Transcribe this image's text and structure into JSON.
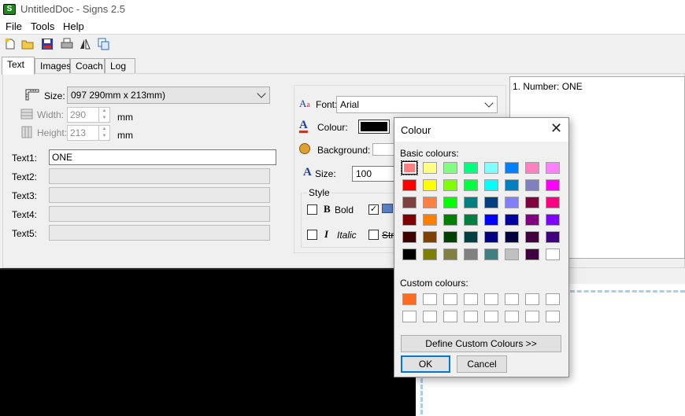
{
  "window": {
    "title": "UntitledDoc - Signs 2.5",
    "app_icon": "S"
  },
  "menu": [
    "File",
    "Tools",
    "Help"
  ],
  "toolbar_icons": [
    "new-file-icon",
    "open-folder-icon",
    "save-icon",
    "print-icon",
    "mirror-icon",
    "copy-icon"
  ],
  "tabs": [
    "Text",
    "Images",
    "Coach",
    "Log"
  ],
  "size": {
    "label": "Size:",
    "value": "097 290mm x 213mm)"
  },
  "width": {
    "label": "Width:",
    "value": "290",
    "unit": "mm"
  },
  "height": {
    "label": "Height:",
    "value": "213",
    "unit": "mm"
  },
  "texts": [
    {
      "label": "Text1:",
      "value": "ONE"
    },
    {
      "label": "Text2:",
      "value": ""
    },
    {
      "label": "Text3:",
      "value": ""
    },
    {
      "label": "Text4:",
      "value": ""
    },
    {
      "label": "Text5:",
      "value": ""
    }
  ],
  "font": {
    "label": "Font:",
    "value": "Arial"
  },
  "colour": {
    "label": "Colour:",
    "swatch": "#000000"
  },
  "background": {
    "label": "Background:"
  },
  "font_size": {
    "label": "Size:",
    "value": "100"
  },
  "style": {
    "title": "Style",
    "bold": "Bold",
    "italic": "Italic",
    "strike": "Stri"
  },
  "number_list": [
    "1. Number: ONE"
  ],
  "dialog": {
    "title": "Colour",
    "basic_label": "Basic colours:",
    "custom_label": "Custom colours:",
    "define_button": "Define Custom Colours >>",
    "ok_button": "OK",
    "cancel_button": "Cancel",
    "basic_colours": [
      [
        "#ff8080",
        "#ffff80",
        "#80ff80",
        "#00ff80",
        "#80ffff",
        "#0080ff",
        "#ff80c0",
        "#ff80ff"
      ],
      [
        "#ff0000",
        "#ffff00",
        "#80ff00",
        "#00ff40",
        "#00ffff",
        "#0080c0",
        "#8080c0",
        "#ff00ff"
      ],
      [
        "#804040",
        "#ff8040",
        "#00ff00",
        "#008080",
        "#004080",
        "#8080ff",
        "#800040",
        "#ff0080"
      ],
      [
        "#800000",
        "#ff8000",
        "#008000",
        "#008040",
        "#0000ff",
        "#0000a0",
        "#800080",
        "#8000ff"
      ],
      [
        "#400000",
        "#804000",
        "#004000",
        "#004040",
        "#000080",
        "#000040",
        "#400040",
        "#400080"
      ],
      [
        "#000000",
        "#808000",
        "#808040",
        "#808080",
        "#408080",
        "#c0c0c0",
        "#400040",
        "#ffffff"
      ]
    ],
    "custom_colours": [
      [
        "#ff6a21",
        "#ffffff",
        "#ffffff",
        "#ffffff",
        "#ffffff",
        "#ffffff",
        "#ffffff",
        "#ffffff"
      ],
      [
        "#ffffff",
        "#ffffff",
        "#ffffff",
        "#ffffff",
        "#ffffff",
        "#ffffff",
        "#ffffff",
        "#ffffff"
      ]
    ]
  }
}
